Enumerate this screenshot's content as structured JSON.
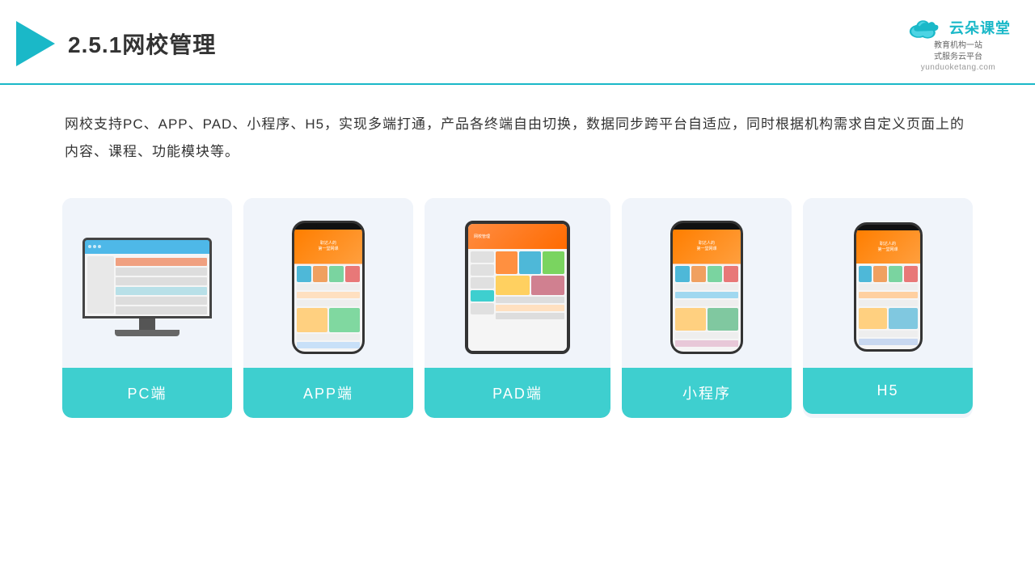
{
  "header": {
    "title": "2.5.1网校管理",
    "brand_name": "云朵课堂",
    "brand_url": "yunduoketang.com",
    "brand_tagline": "教育机构一站\n式服务云平台"
  },
  "description": {
    "text": "网校支持PC、APP、PAD、小程序、H5，实现多端打通，产品各终端自由切换，数据同步跨平台自适应，同时根据机构需求自定义页面上的内容、课程、功能模块等。"
  },
  "cards": [
    {
      "label": "PC端",
      "type": "pc"
    },
    {
      "label": "APP端",
      "type": "phone"
    },
    {
      "label": "PAD端",
      "type": "tablet"
    },
    {
      "label": "小程序",
      "type": "phone2"
    },
    {
      "label": "H5",
      "type": "phone3"
    }
  ],
  "accent_color": "#3ecfcf",
  "arrow_color": "#1ab8c8"
}
